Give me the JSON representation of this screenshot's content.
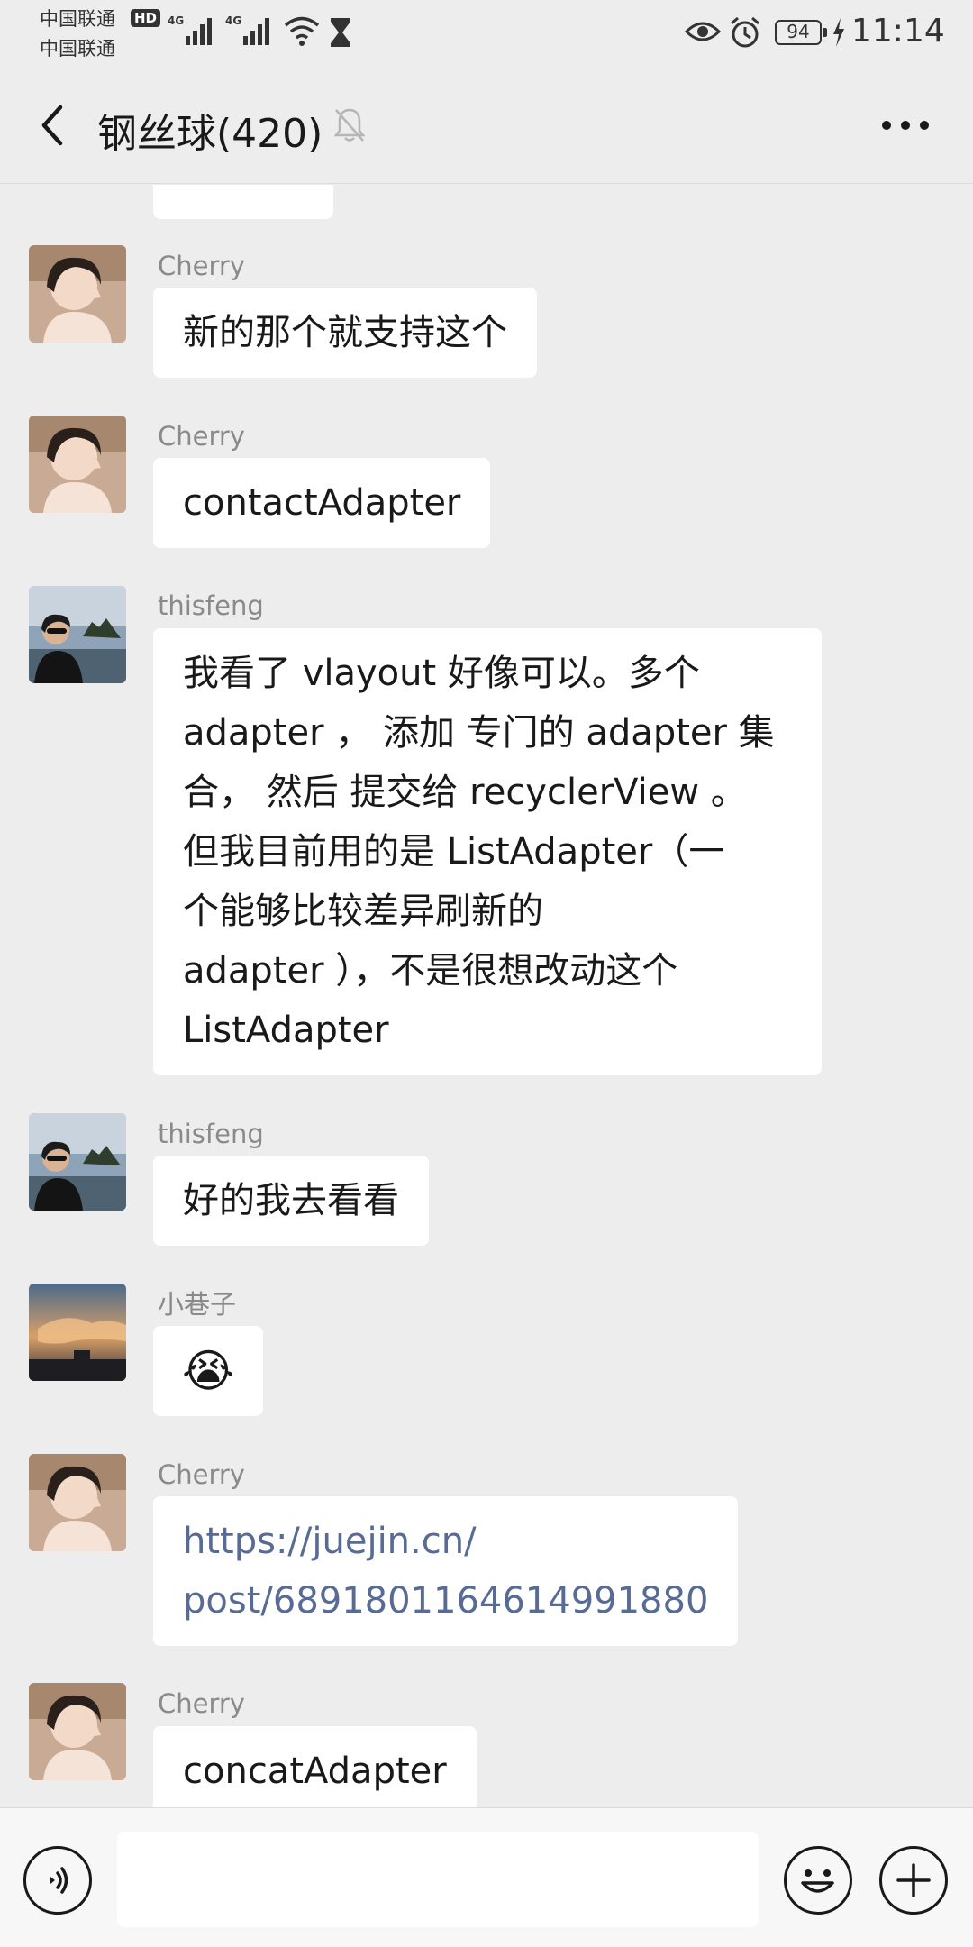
{
  "status_bar": {
    "carrier_1": "中国联通",
    "carrier_2": "中国联通",
    "hd_badge": "HD",
    "network_1": "4G",
    "network_2": "4G",
    "battery_level": "94",
    "time": "11:14",
    "icons": [
      "signal-icon",
      "signal-icon",
      "wifi-icon",
      "hourglass-icon",
      "eye-icon",
      "alarm-icon",
      "battery-icon",
      "charging-icon"
    ]
  },
  "nav": {
    "back_icon": "chevron-left-icon",
    "title": "钢丝球(420)",
    "mute_icon": "bell-off-icon",
    "more_icon": "more-dots-icon"
  },
  "messages": [
    {
      "sender": "Cherry",
      "text": "新的那个就支持这个"
    },
    {
      "sender": "Cherry",
      "text": "contactAdapter"
    },
    {
      "sender": "thisfeng",
      "lines": [
        "我看了 vlayout 好像可以。多个",
        "adapter ， 添加 专门的 adapter 集",
        "合， 然后 提交给 recyclerView 。",
        "但我目前用的是 ListAdapter（一",
        "个能够比较差异刷新的",
        "adapter ），不是很想改动这个",
        "ListAdapter"
      ]
    },
    {
      "sender": "thisfeng",
      "text": "好的我去看看"
    },
    {
      "sender": "小巷子",
      "emoji": "😭"
    },
    {
      "sender": "Cherry",
      "lines": [
        "https://juejin.cn/",
        "post/6891801164614991880"
      ]
    },
    {
      "sender": "Cherry",
      "text": "concatAdapter"
    }
  ],
  "input_bar": {
    "voice_icon": "voice-icon",
    "emoji_icon": "emoji-icon",
    "plus_icon": "plus-icon",
    "input_value": ""
  },
  "colors": {
    "background": "#ededed",
    "bubble": "#ffffff",
    "link": "#576b95",
    "sender_name": "#8a8a8a"
  }
}
